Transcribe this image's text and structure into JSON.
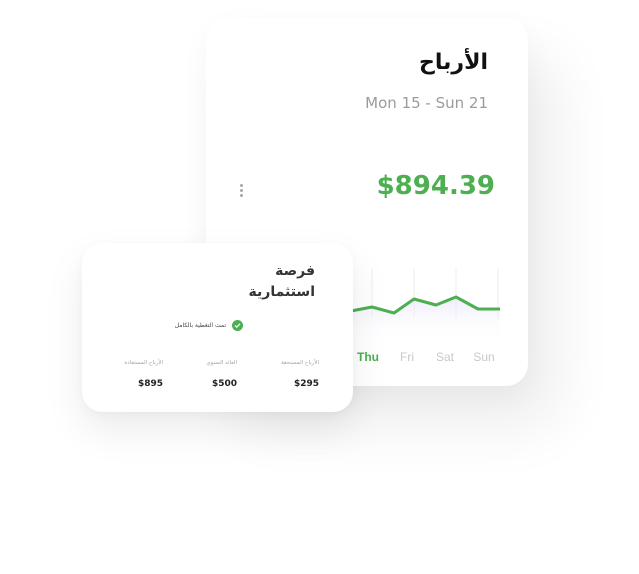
{
  "earnings": {
    "title": "الأرباح",
    "date_range": "Mon 15 - Sun 21",
    "amount": "$894.39",
    "accent_color": "#4caf50",
    "day_labels": [
      "Thu",
      "Fri",
      "Sat",
      "Sun"
    ],
    "active_day": "Thu"
  },
  "investment": {
    "title_line1": "فرصة",
    "title_line2": "استثمارية",
    "status_text": "تمت التغطية بالكامل",
    "stats": [
      {
        "label": "الأرباح المستحقة",
        "value": "$295"
      },
      {
        "label": "العائد السنوي",
        "value": "$500"
      },
      {
        "label": "الأرباح المستفادة",
        "value": "$895"
      }
    ]
  }
}
